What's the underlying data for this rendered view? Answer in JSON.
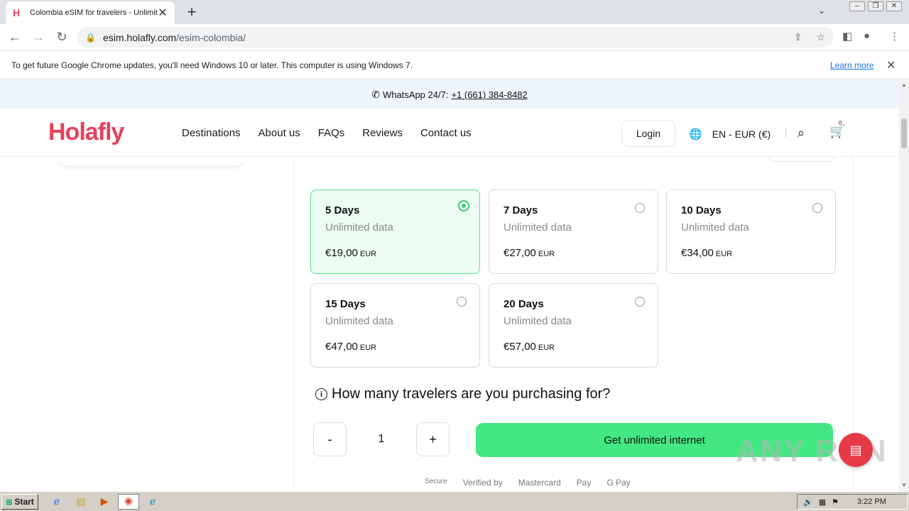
{
  "browser": {
    "tab_title": "Colombia eSIM for travelers - Unlimit",
    "url_domain": "esim.holafly.com",
    "url_path": "/esim-colombia/",
    "infobar_text": "To get future Google Chrome updates, you'll need Windows 10 or later. This computer is using Windows 7.",
    "infobar_link": "Learn more"
  },
  "topbar": {
    "whatsapp_label": "WhatsApp 24/7:",
    "phone": "+1 (661) 384-8482"
  },
  "header": {
    "logo": "Holafly",
    "nav": [
      "Destinations",
      "About us",
      "FAQs",
      "Reviews",
      "Contact us"
    ],
    "login": "Login",
    "language": "EN - EUR (€)",
    "cart_count": "0"
  },
  "plans": [
    {
      "days": "5 Days",
      "data": "Unlimited data",
      "price": "€19,00",
      "currency": "EUR",
      "selected": true
    },
    {
      "days": "7 Days",
      "data": "Unlimited data",
      "price": "€27,00",
      "currency": "EUR",
      "selected": false
    },
    {
      "days": "10 Days",
      "data": "Unlimited data",
      "price": "€34,00",
      "currency": "EUR",
      "selected": false
    },
    {
      "days": "15 Days",
      "data": "Unlimited data",
      "price": "€47,00",
      "currency": "EUR",
      "selected": false
    },
    {
      "days": "20 Days",
      "data": "Unlimited data",
      "price": "€57,00",
      "currency": "EUR",
      "selected": false
    }
  ],
  "purchase": {
    "question": "How many travelers are you purchasing for?",
    "minus": "-",
    "quantity": "1",
    "plus": "+",
    "cta": "Get unlimited internet"
  },
  "payments": {
    "secure": "Secure",
    "verified": "Verified by",
    "mastercard": "Mastercard",
    "apple": "Pay",
    "google": "G Pay"
  },
  "watermark": "ANY RUN",
  "taskbar": {
    "start": "Start",
    "clock": "3:22 PM"
  }
}
